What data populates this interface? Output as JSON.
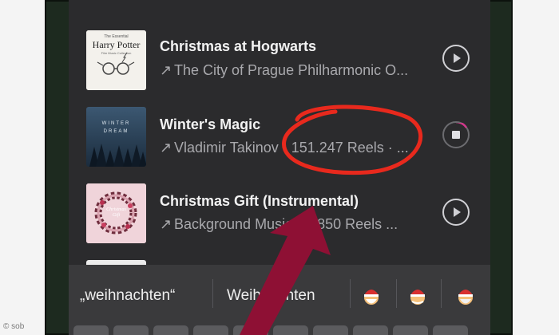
{
  "tracks": [
    {
      "title": "Christmas at Hogwarts",
      "subtitle": "The City of Prague Philharmonic O...",
      "cover_text": "Harry Potter",
      "cover_small": "The Essential",
      "cover_caption": "Film Music Collection",
      "state": "play"
    },
    {
      "title": "Winter's Magic",
      "subtitle": "Vladimir Takinov · 151.247 Reels · ...",
      "cover_text": "WINTER DREAM",
      "state": "playing"
    },
    {
      "title": "Christmas Gift (Instrumental)",
      "subtitle": "Background Music · 4.850 Reels ...",
      "cover_text": "Christmas Gift",
      "state": "play"
    }
  ],
  "keyboard": {
    "suggestion_1": "„weihnachten“",
    "suggestion_2": "Weihnachten"
  },
  "credit": "© sob",
  "colors": {
    "annotation": "#e8291d",
    "arrow": "#8e1034",
    "progress": "#d0388a"
  },
  "icons": [
    "arrow-up-right-icon",
    "play-icon",
    "stop-icon",
    "santa-emoji",
    "mrs-claus-emoji",
    "elf-emoji"
  ]
}
